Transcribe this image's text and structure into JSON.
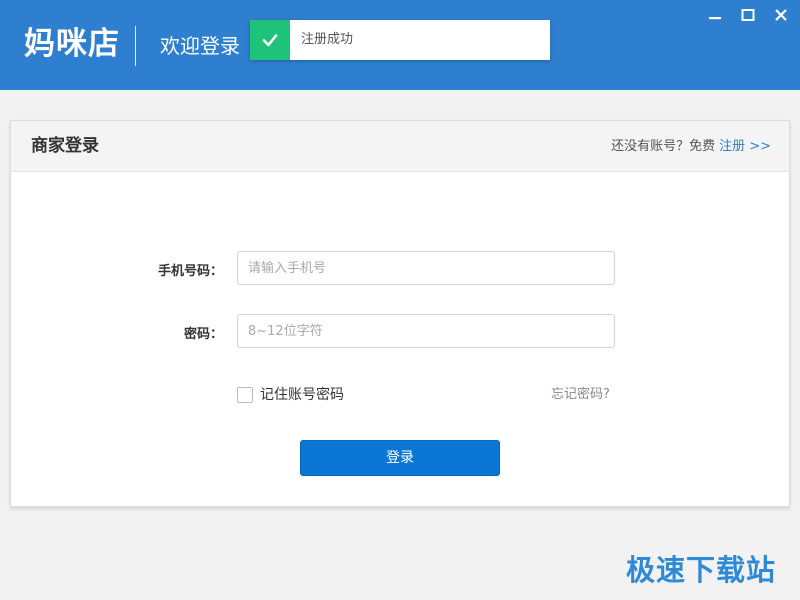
{
  "header": {
    "logo": "妈咪店",
    "welcome": "欢迎登录",
    "toast": {
      "message": "注册成功",
      "icon": "check-icon",
      "accent": "#1fc279"
    },
    "window_controls": [
      "minimize-icon",
      "maximize-icon",
      "close-icon"
    ],
    "brand_color": "#2f7fd0"
  },
  "panel": {
    "title": "商家登录",
    "register_prompt": "还没有账号？免费",
    "register_link": "注册 >>"
  },
  "form": {
    "phone": {
      "label": "手机号码：",
      "placeholder": "请输入手机号",
      "value": ""
    },
    "password": {
      "label": "密码：",
      "placeholder": "8~12位字符",
      "value": ""
    },
    "remember": {
      "label": "记住账号密码",
      "checked": false
    },
    "forgot": "忘记密码?",
    "submit": "登录",
    "button_color": "#0a77d7"
  },
  "watermark": "极速下载站"
}
